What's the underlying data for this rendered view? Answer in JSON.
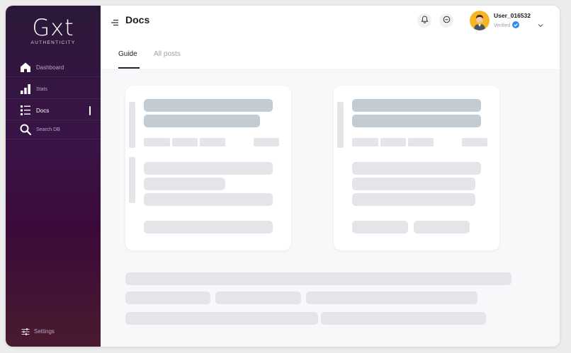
{
  "brand": {
    "logo": "Gxt",
    "tagline": "AUTHENTICITY"
  },
  "sidebar": {
    "items": [
      {
        "label": "Dashboard",
        "icon": "home-icon",
        "active": false
      },
      {
        "label": "Stats",
        "icon": "bar-chart-icon",
        "active": false
      },
      {
        "label": "Docs",
        "icon": "document-list-icon",
        "active": true
      },
      {
        "label": "Search DB",
        "icon": "search-icon",
        "active": false
      }
    ],
    "settings_label": "Settings"
  },
  "header": {
    "title": "Docs",
    "user": {
      "name": "User_016532",
      "status": "Verified"
    }
  },
  "tabs": [
    {
      "label": "Guide",
      "active": true
    },
    {
      "label": "All posts",
      "active": false
    }
  ],
  "colors": {
    "sidebar_top": "#2b1838",
    "sidebar_bottom": "#4a1a2f",
    "verified_badge": "#2d8cf0",
    "skeleton_dark": "#c3ccd3",
    "skeleton_light": "#e3e5e8"
  }
}
